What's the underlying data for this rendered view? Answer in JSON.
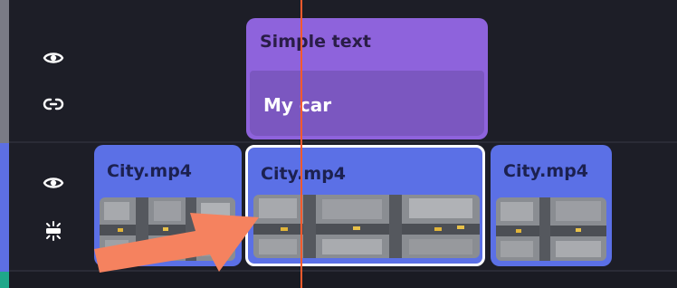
{
  "tracks": {
    "text_track": {
      "clip": {
        "title": "Simple text",
        "content": "My car"
      }
    },
    "video_track": {
      "clips": [
        {
          "label": "City.mp4"
        },
        {
          "label": "City.mp4",
          "selected": true
        },
        {
          "label": "City.mp4"
        }
      ]
    }
  },
  "icons": {
    "text_track_visibility": "eye-icon",
    "text_track_link": "link-icon",
    "video_track_visibility": "eye-icon",
    "video_track_effects": "sparkle-icon"
  },
  "colors": {
    "text_clip": "#8e63dc",
    "video_clip": "#5b70e6",
    "playhead": "#ff5a2c",
    "annotation_arrow": "#f5825f",
    "selected_border": "#ffffff"
  }
}
